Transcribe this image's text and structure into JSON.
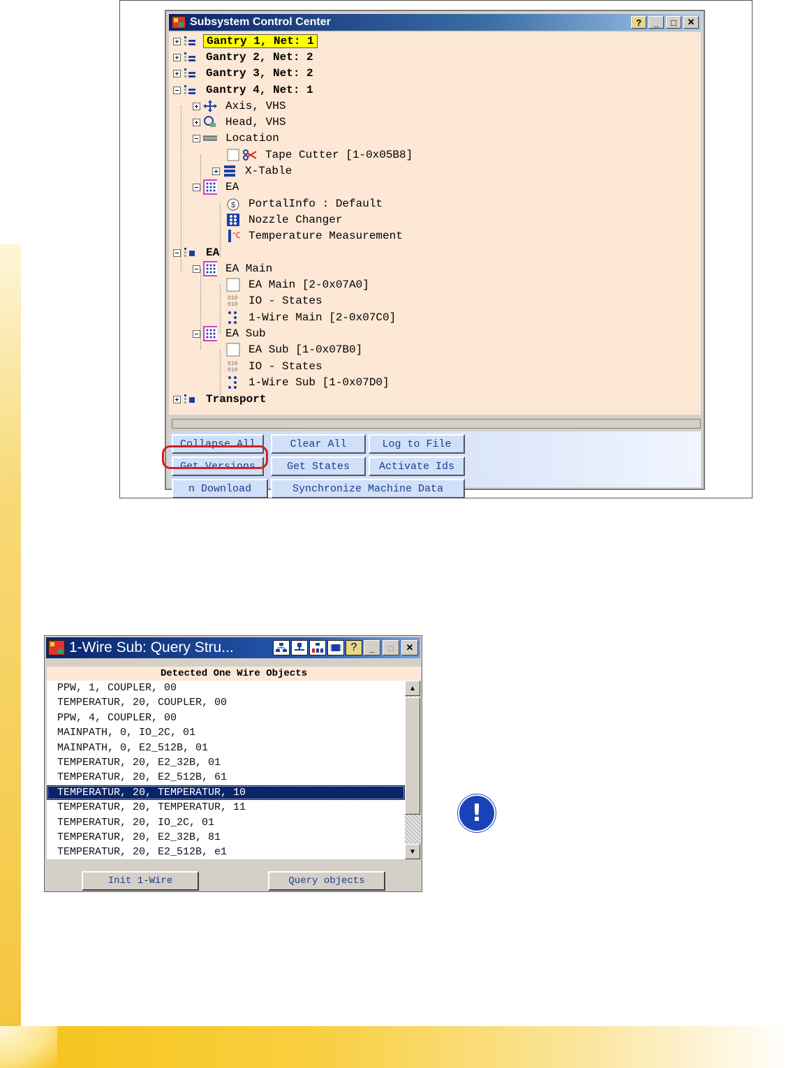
{
  "main_window": {
    "title": "Subsystem Control Center",
    "tree": [
      {
        "label": "Gantry 1, Net: 1",
        "icon": "gantry-icon"
      },
      {
        "label": "Gantry 2, Net: 2",
        "icon": "gantry-icon"
      },
      {
        "label": "Gantry 3, Net: 2",
        "icon": "gantry-icon"
      },
      {
        "label": "Gantry 4, Net: 1",
        "icon": "gantry-icon"
      },
      {
        "label": "Axis, VHS",
        "icon": "axis-icon"
      },
      {
        "label": "Head, VHS",
        "icon": "head-icon"
      },
      {
        "label": "Location",
        "icon": "location-icon"
      },
      {
        "label": "Tape Cutter [1-0x05B8]",
        "icon": "scissors-icon"
      },
      {
        "label": "X-Table",
        "icon": "x-table-icon"
      },
      {
        "label": "EA",
        "icon": "ea-grid-icon"
      },
      {
        "label": "PortalInfo : Default",
        "icon": "portal-info-icon"
      },
      {
        "label": "Nozzle Changer",
        "icon": "nozzle-changer-icon"
      },
      {
        "label": "Temperature Measurement",
        "icon": "thermometer-icon"
      },
      {
        "label": "EA",
        "icon": "ea-root-icon"
      },
      {
        "label": "EA Main",
        "icon": "ea-grid-icon"
      },
      {
        "label": "EA Main [2-0x07A0]",
        "icon": "module-box-icon"
      },
      {
        "label": "IO - States",
        "icon": "io-states-icon"
      },
      {
        "label": "1-Wire Main [2-0x07C0]",
        "icon": "one-wire-icon"
      },
      {
        "label": "EA Sub",
        "icon": "ea-grid-icon"
      },
      {
        "label": "EA Sub [1-0x07B0]",
        "icon": "module-box-icon"
      },
      {
        "label": "IO - States",
        "icon": "io-states-icon"
      },
      {
        "label": "1-Wire Sub [1-0x07D0]",
        "icon": "one-wire-icon"
      },
      {
        "label": "Transport",
        "icon": "transport-icon"
      }
    ],
    "buttons": {
      "collapse_all": "Collapse All",
      "clear_all": "Clear All",
      "log_to_file": "Log to File",
      "get_versions": "Get Versions",
      "get_states": "Get States",
      "activate_ids": "Activate Ids",
      "download": "n Download",
      "synchronize": "Synchronize Machine Data"
    }
  },
  "query_window": {
    "title": "1-Wire Sub: Query Stru...",
    "list_header": "Detected One Wire Objects",
    "items": [
      "PPW, 1, COUPLER, 00",
      "TEMPERATUR, 20, COUPLER, 00",
      "PPW, 4, COUPLER, 00",
      "MAINPATH, 0, IO_2C, 01",
      "MAINPATH, 0, E2_512B, 01",
      "TEMPERATUR, 20, E2_32B, 01",
      "TEMPERATUR, 20, E2_512B, 61",
      "TEMPERATUR, 20, TEMPERATUR, 10",
      "TEMPERATUR, 20, TEMPERATUR, 11",
      "TEMPERATUR, 20, IO_2C, 01",
      "TEMPERATUR, 20, E2_32B, 81",
      "TEMPERATUR, 20, E2_512B, e1"
    ],
    "selected_index": 7,
    "buttons": {
      "init": "Init 1-Wire",
      "query": "Query objects"
    }
  },
  "colors": {
    "tree_bg": "#fce8d5",
    "highlight": "#ffff00",
    "selection": "#0a246a",
    "button_text": "#1c3c8c",
    "annotation_ring": "#d42020",
    "accent_yellow": "#f6c31a"
  }
}
